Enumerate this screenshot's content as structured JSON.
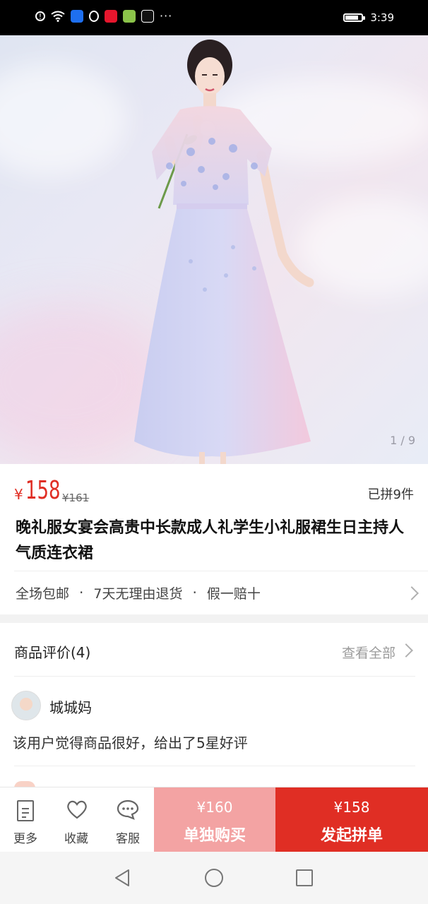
{
  "status_bar": {
    "time": "3:39",
    "icons": [
      "warning-icon",
      "wifi-icon",
      "shield-app-icon",
      "qq-icon",
      "weibo-icon",
      "fruit-app-icon",
      "tiktok-icon",
      "more-dots-icon",
      "battery-icon"
    ],
    "more_dots": "···"
  },
  "gallery": {
    "image_counter": "1 / 9"
  },
  "product": {
    "currency": "¥",
    "price": "158",
    "original_price": "¥161",
    "sold_count": "已拼9件",
    "title": "晚礼服女宴会高贵中长款成人礼学生小礼服裙生日主持人气质连衣裙",
    "services": [
      "全场包邮",
      "7天无理由退货",
      "假一赔十"
    ],
    "service_separator": "·"
  },
  "reviews": {
    "heading": "商品评价(4)",
    "view_all": "查看全部",
    "items": [
      {
        "reviewer": "城城妈",
        "text": "该用户觉得商品很好，给出了5星好评"
      }
    ]
  },
  "action_bar": {
    "more_label": "更多",
    "favorite_label": "收藏",
    "service_label": "客服",
    "single_buy_price": "¥160",
    "single_buy_label": "单独购买",
    "group_buy_price": "¥158",
    "group_buy_label": "发起拼单"
  },
  "colors": {
    "accent": "#e02e24",
    "single_buy_bg": "#f3a3a3",
    "status_bar_bg": "#000000"
  }
}
